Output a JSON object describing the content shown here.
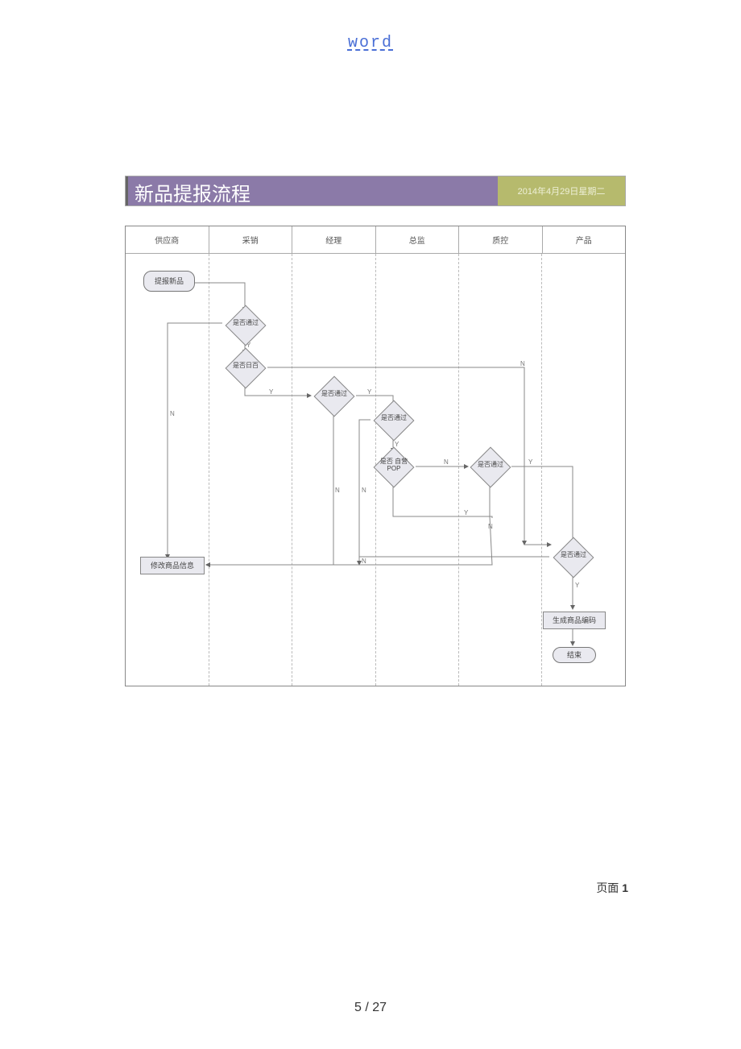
{
  "header_link": "word",
  "page_number": "5 / 27",
  "page_label_prefix": "页面 ",
  "page_label_num": "1",
  "title": "新品提报流程",
  "date_text": "2014年4月29日星期二",
  "lanes": [
    "供应商",
    "采销",
    "经理",
    "总监",
    "质控",
    "产品"
  ],
  "nodes": {
    "start": "提报新品",
    "d1": "是否通过",
    "d2": "是否日百",
    "d3": "是否通过",
    "d4": "是否通过",
    "d5": "是否 自营POP",
    "d6": "是否通过",
    "d7": "是否通过",
    "modify": "修改商品信息",
    "gen": "生成商品编码",
    "end": "结束"
  },
  "edge_labels": {
    "Y": "Y",
    "N": "N"
  }
}
